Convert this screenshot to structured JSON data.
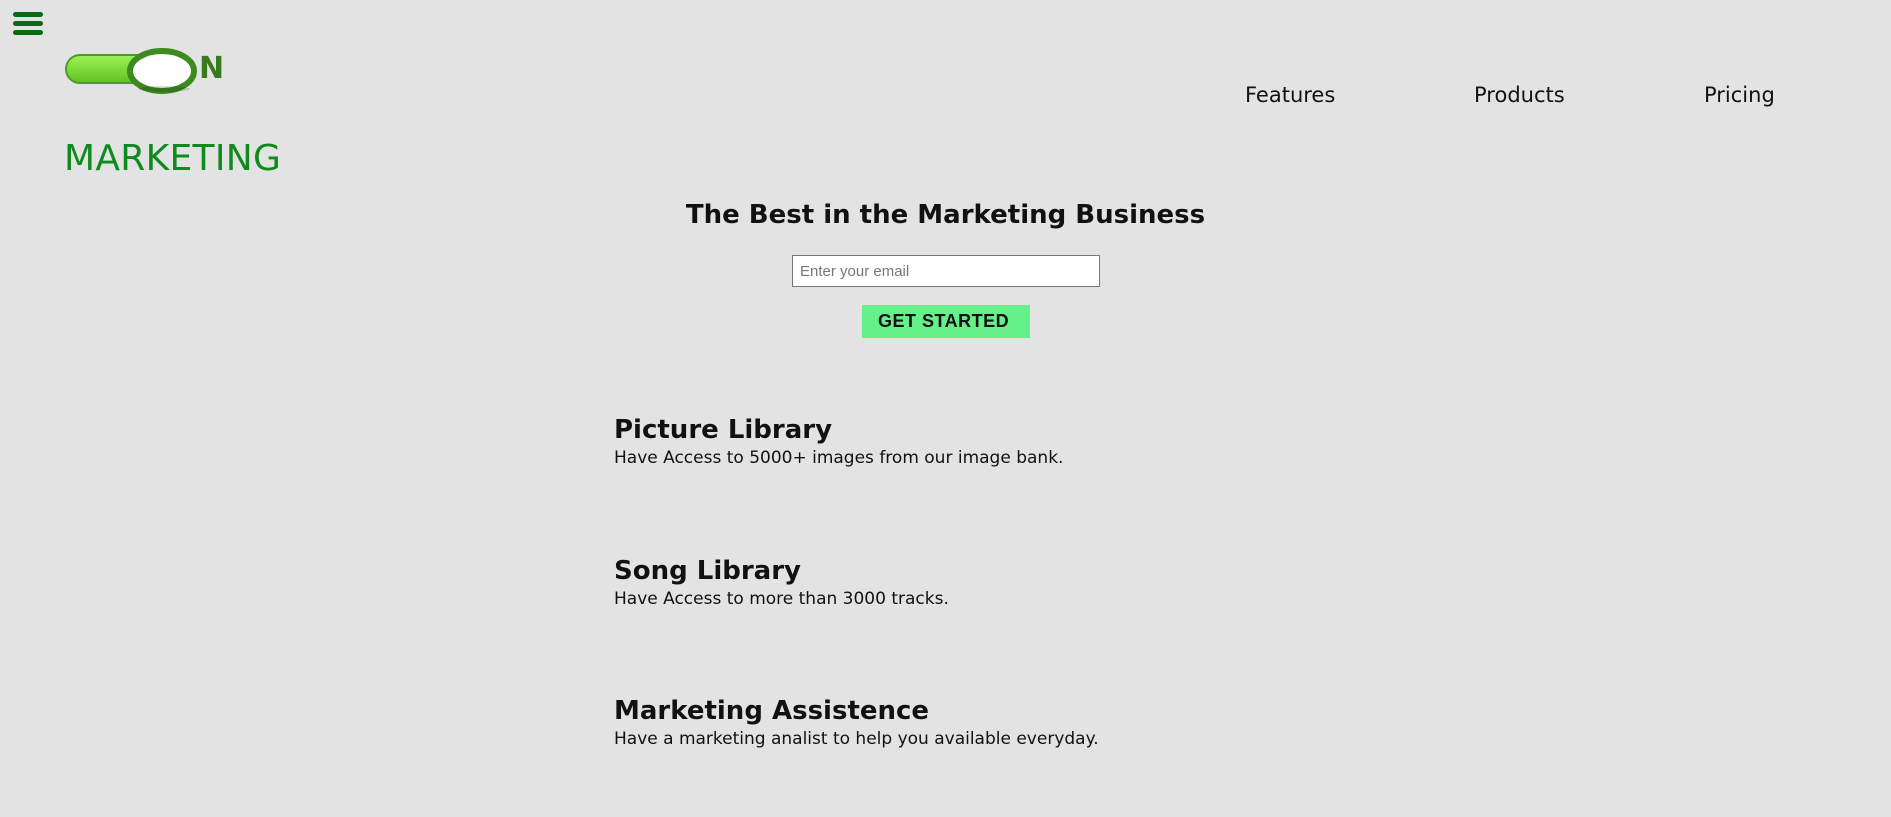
{
  "header": {
    "brand_title": "MARKETING",
    "logo_letter": "N",
    "menu_icon": "hamburger-menu-icon",
    "nav": [
      {
        "label": "Features"
      },
      {
        "label": "Products"
      },
      {
        "label": "Pricing"
      }
    ]
  },
  "hero": {
    "heading": "The Best in the Marketing Business",
    "email_placeholder": "Enter your email",
    "email_value": "",
    "cta_label": "GET STARTED"
  },
  "features": [
    {
      "title": "Picture Library",
      "description": "Have Access to 5000+ images from our image bank."
    },
    {
      "title": "Song Library",
      "description": "Have Access to more than 3000 tracks."
    },
    {
      "title": "Marketing Assistence",
      "description": "Have a marketing analist to help you available everyday."
    }
  ],
  "colors": {
    "background": "#e3e3e3",
    "brand_green": "#0f8a1d",
    "menu_green": "#0b6b14",
    "cta_green": "#66f08a",
    "toggle_green": "#7fdb3a"
  }
}
